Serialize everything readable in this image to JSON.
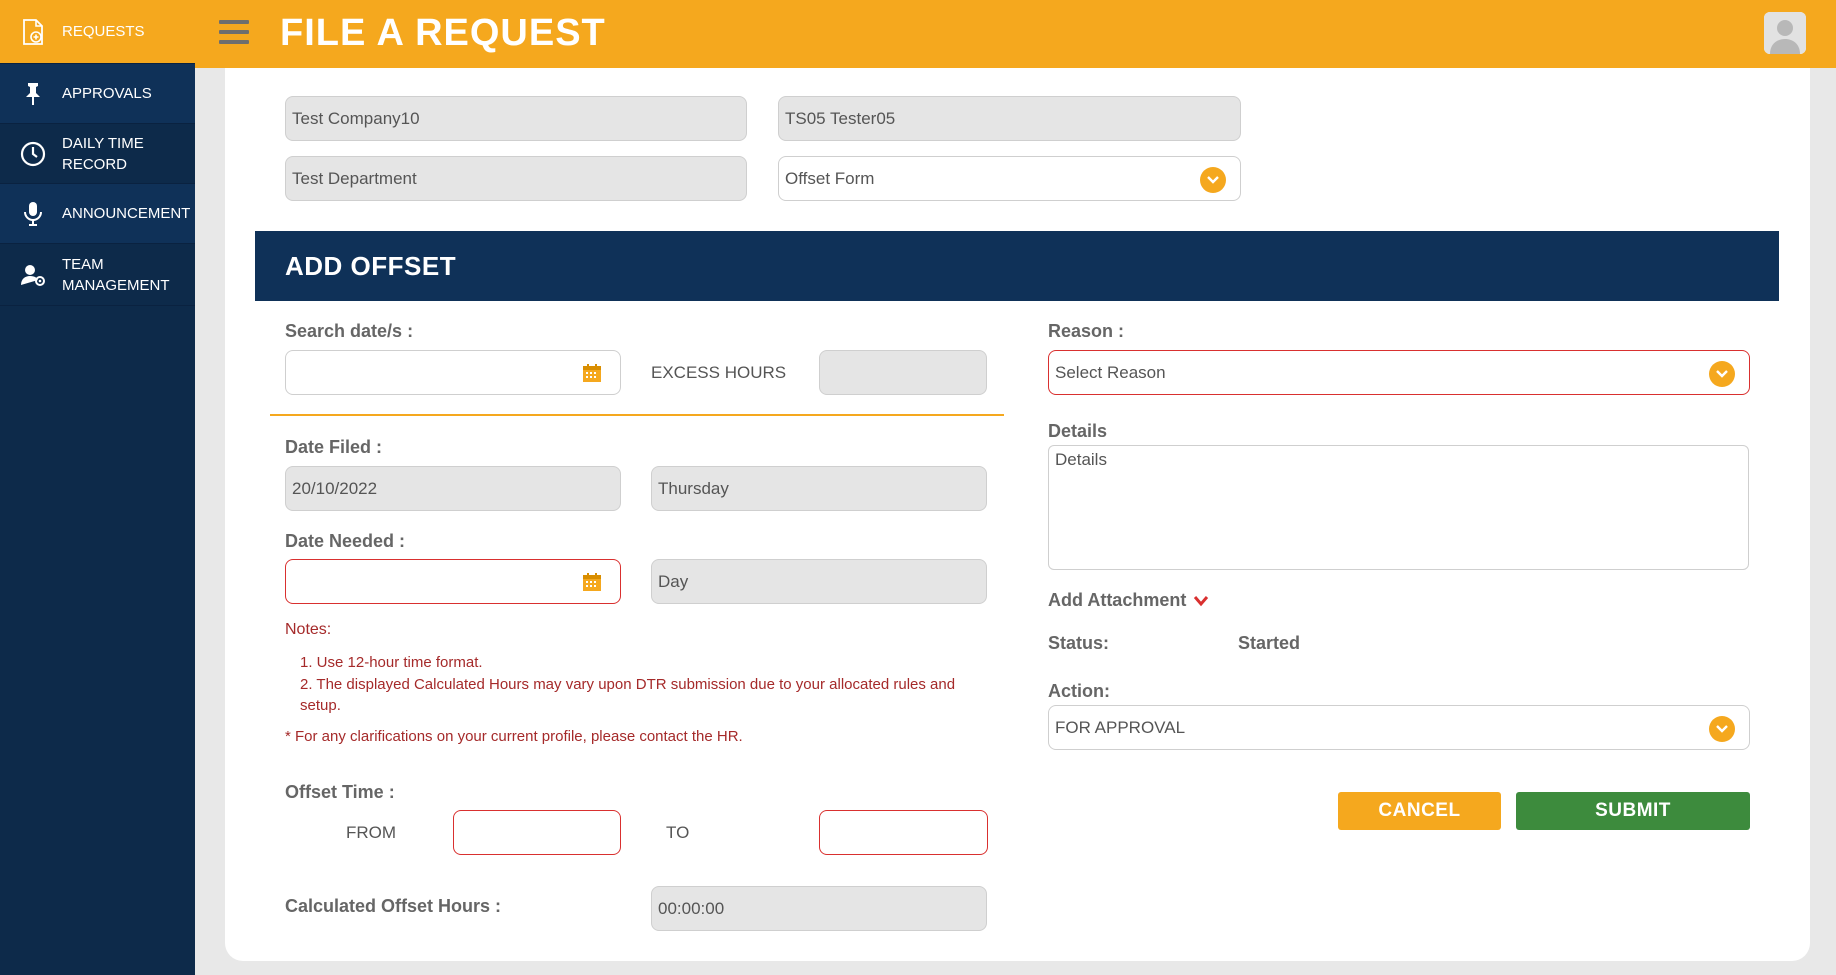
{
  "sidebar": {
    "items": [
      {
        "label": "REQUESTS",
        "icon": "request-file-icon"
      },
      {
        "label": "APPROVALS",
        "icon": "pin-icon"
      },
      {
        "label": "DAILY TIME RECORD",
        "icon": "clock-icon"
      },
      {
        "label": "ANNOUNCEMENT",
        "icon": "microphone-icon"
      },
      {
        "label": "TEAM MANAGEMENT",
        "icon": "user-settings-icon"
      }
    ]
  },
  "header": {
    "title": "FILE A REQUEST"
  },
  "top_fields": {
    "company": "Test Company10",
    "employee": "TS05 Tester05",
    "department": "Test Department",
    "form_type": "Offset Form"
  },
  "section": {
    "title": "ADD OFFSET"
  },
  "form": {
    "search_dates_label": "Search date/s :",
    "search_dates_value": "",
    "excess_hours_label": "EXCESS HOURS",
    "excess_hours_value": "",
    "date_filed_label": "Date Filed :",
    "date_filed_value": "20/10/2022",
    "date_filed_day": "Thursday",
    "date_needed_label": "Date Needed :",
    "date_needed_value": "",
    "date_needed_day": "Day",
    "notes_title": "Notes:",
    "note_1": "1. Use 12-hour time format.",
    "note_2a": "2. The displayed Calculated Hours may vary upon DTR submission due to your allocated rules and",
    "note_2b": "setup.",
    "note_3": "* For any clarifications on your current profile, please contact the HR.",
    "offset_time_label": "Offset Time :",
    "from_label": "FROM",
    "to_label": "TO",
    "calc_hours_label": "Calculated Offset Hours :",
    "calc_hours_value": "00:00:00",
    "reason_label": "Reason :",
    "reason_value": "Select Reason",
    "details_label": "Details",
    "details_placeholder": "Details",
    "attachment_label": "Add Attachment",
    "status_label": "Status:",
    "status_value": "Started",
    "action_label": "Action:",
    "action_value": "FOR APPROVAL"
  },
  "buttons": {
    "cancel": "CANCEL",
    "submit": "SUBMIT"
  },
  "colors": {
    "accent": "#f5a81e",
    "navy": "#0f3158",
    "submit": "#3d8b3d",
    "error": "#d9302f"
  }
}
